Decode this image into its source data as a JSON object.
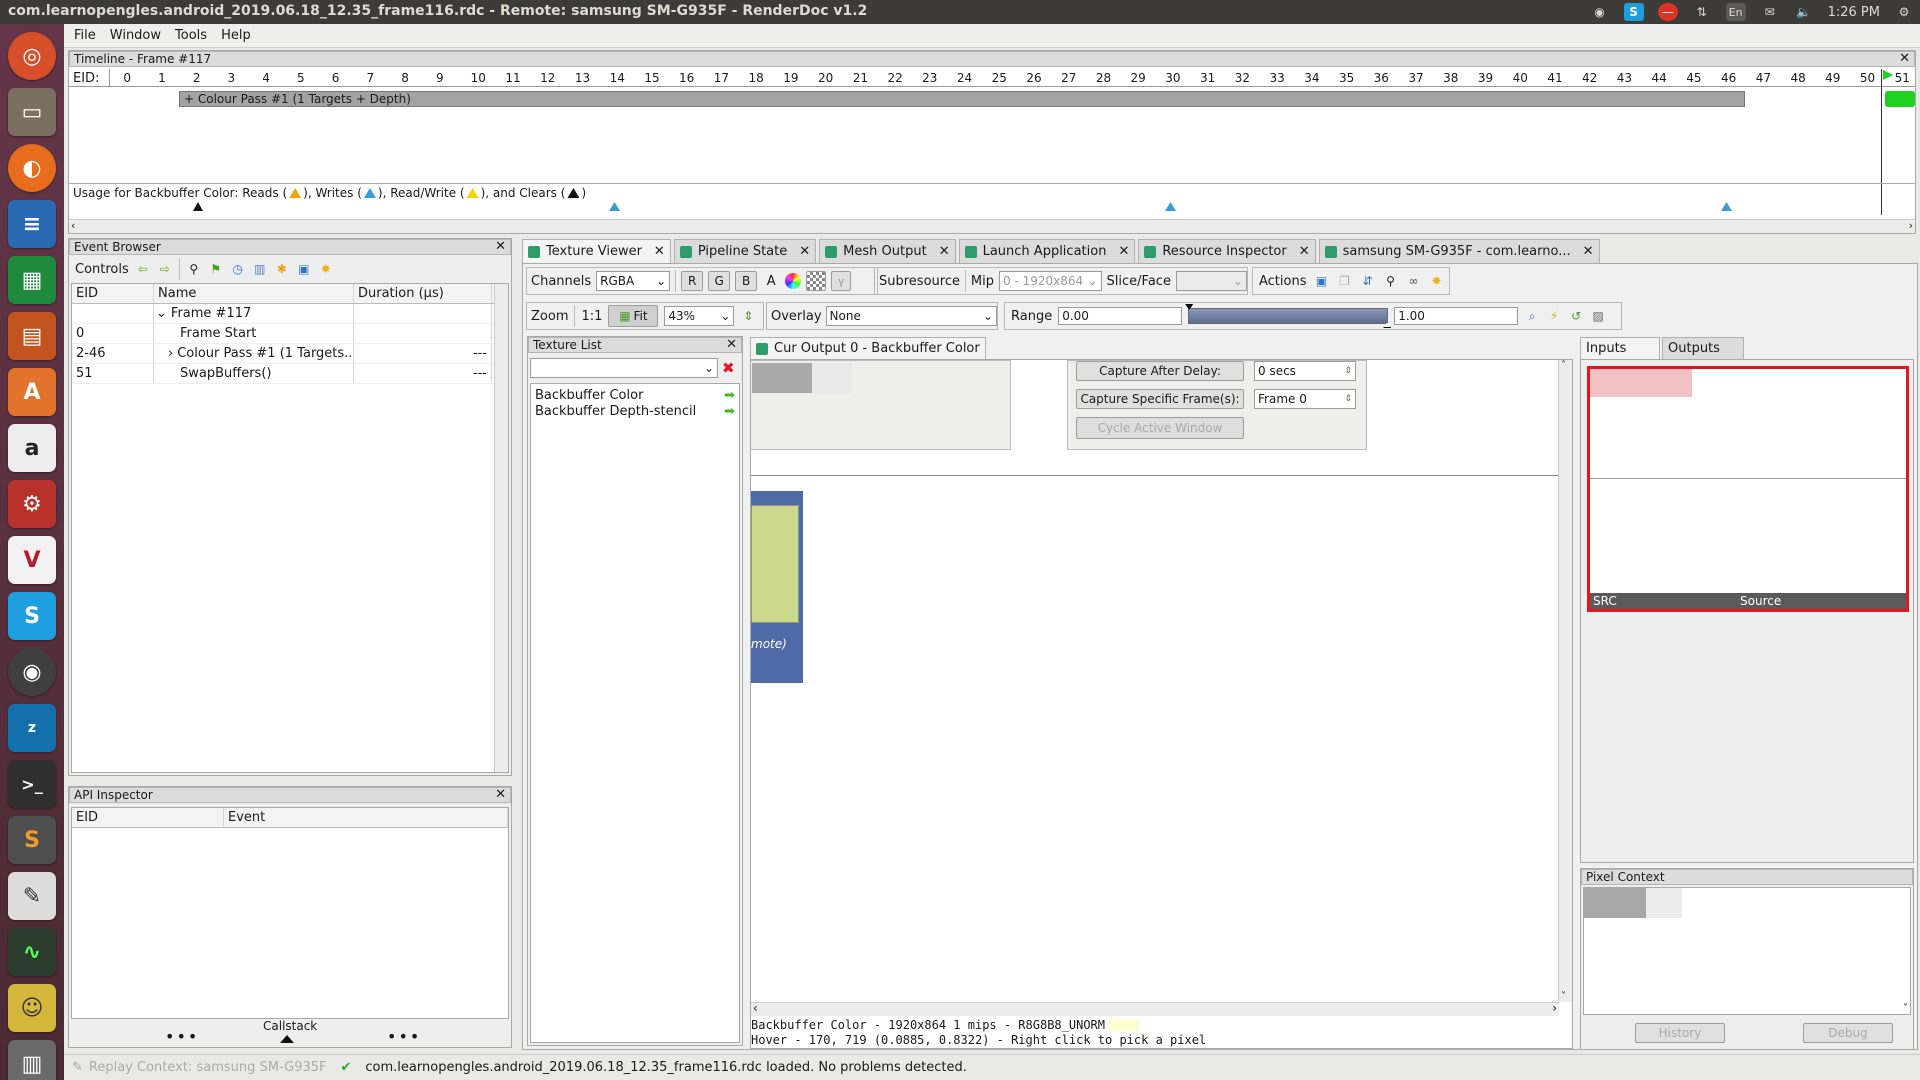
{
  "window_title": "com.learnopengles.android_2019.06.18_12.35_frame116.rdc - Remote: samsung SM-G935F - RenderDoc v1.2",
  "tray": {
    "lang": "En",
    "time": "1:26 PM"
  },
  "menu": [
    "File",
    "Window",
    "Tools",
    "Help"
  ],
  "timeline": {
    "title": "Timeline - Frame #117",
    "eid_label": "EID:",
    "ticks": [
      "0",
      "1",
      "2",
      "3",
      "4",
      "5",
      "6",
      "7",
      "8",
      "9",
      "10",
      "11",
      "12",
      "13",
      "14",
      "15",
      "16",
      "17",
      "18",
      "19",
      "20",
      "21",
      "22",
      "23",
      "24",
      "25",
      "26",
      "27",
      "28",
      "29",
      "30",
      "31",
      "32",
      "33",
      "34",
      "35",
      "36",
      "37",
      "38",
      "39",
      "40",
      "41",
      "42",
      "43",
      "44",
      "45",
      "46",
      "47",
      "48",
      "49",
      "50",
      "51"
    ],
    "pass_label": "+ Colour Pass #1 (1 Targets + Depth)",
    "usage_prefix": "Usage for Backbuffer Color: Reads (",
    "usage_writes": "), Writes (",
    "usage_rw": "), Read/Write (",
    "usage_clears": "), and Clears (",
    "usage_end": ")"
  },
  "event_browser": {
    "title": "Event Browser",
    "controls_label": "Controls",
    "headers": [
      "EID",
      "Name",
      "Duration (µs)"
    ],
    "rows": [
      {
        "eid": "",
        "name": "Frame #117",
        "dur": ""
      },
      {
        "eid": "0",
        "name": "Frame Start",
        "dur": ""
      },
      {
        "eid": "2-46",
        "name": "Colour Pass #1 (1 Targets...",
        "dur": "---"
      },
      {
        "eid": "51",
        "name": "SwapBuffers()",
        "dur": "---"
      }
    ]
  },
  "api_inspector": {
    "title": "API Inspector",
    "headers": [
      "EID",
      "Event"
    ],
    "callstack": "Callstack"
  },
  "tabs": [
    {
      "label": "Texture Viewer"
    },
    {
      "label": "Pipeline State"
    },
    {
      "label": "Mesh Output"
    },
    {
      "label": "Launch Application"
    },
    {
      "label": "Resource Inspector"
    },
    {
      "label": "samsung SM-G935F - com.learno..."
    }
  ],
  "toolbar": {
    "channels_label": "Channels",
    "channels_value": "RGBA",
    "r": "R",
    "g": "G",
    "b": "B",
    "a": "A",
    "subresource_label": "Subresource",
    "mip_label": "Mip",
    "mip_value": "0 - 1920x864",
    "slice_label": "Slice/Face",
    "actions_label": "Actions",
    "zoom_label": "Zoom",
    "zoom_1to1": "1:1",
    "fit_label": "Fit",
    "zoom_value": "43%",
    "overlay_label": "Overlay",
    "overlay_value": "None",
    "range_label": "Range",
    "range_min": "0.00",
    "range_max": "1.00"
  },
  "texture_list": {
    "title": "Texture List",
    "items": [
      "Backbuffer Color",
      "Backbuffer Depth-stencil"
    ]
  },
  "output_tab": "Cur Output 0 - Backbuffer Color",
  "capture": {
    "after_delay_label": "Capture After Delay:",
    "after_delay_value": "0 secs",
    "specific_label": "Capture Specific Frame(s):",
    "specific_value": "Frame 0",
    "cycle_label": "Cycle Active Window"
  },
  "remote_note": "mote)",
  "status_lines": {
    "line1": "Backbuffer Color - 1920x864 1 mips - R8G8B8_UNORM",
    "line2": "Hover -  170,  719 (0.0885, 0.8322) - Right click to pick a pixel"
  },
  "inputs_outputs": {
    "inputs_tab": "Inputs",
    "outputs_tab": "Outputs",
    "src_label": "SRC",
    "source_label": "Source"
  },
  "pixel_context": {
    "title": "Pixel Context",
    "history": "History",
    "debug": "Debug"
  },
  "statusbar": {
    "replay": "Replay Context: samsung SM-G935F",
    "message": "com.learnopengles.android_2019.06.18_12.35_frame116.rdc loaded. No problems detected."
  },
  "colors": {
    "accent_red": "#e8141f",
    "pass_bar": "#a3a3a3",
    "output_blue": "#4f6aa6",
    "output_yellow": "#ccd88d"
  }
}
